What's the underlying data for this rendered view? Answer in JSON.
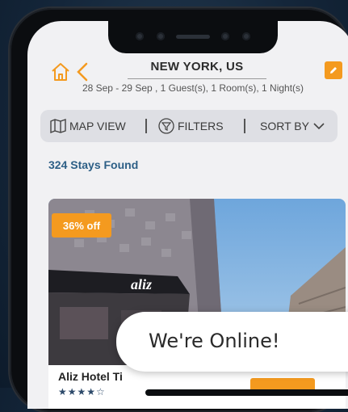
{
  "header": {
    "city": "NEW YORK, US",
    "trip_summary": "28 Sep -  29 Sep , 1 Guest(s), 1 Room(s), 1 Night(s)"
  },
  "toolbar": {
    "map_label": "MAP VIEW",
    "filters_label": "FILTERS",
    "sort_label": "SORT BY"
  },
  "results": {
    "count_label": "324 Stays Found"
  },
  "listing": {
    "discount": "36% off",
    "hotel_name": "Aliz Hotel Ti",
    "stars": "★★★★☆",
    "sign_text": "aliz"
  },
  "chat": {
    "label": "We're Online!"
  },
  "colors": {
    "accent": "#f49a1f",
    "count_text": "#2d5f86",
    "toolbar_bg": "#dedfe4"
  }
}
